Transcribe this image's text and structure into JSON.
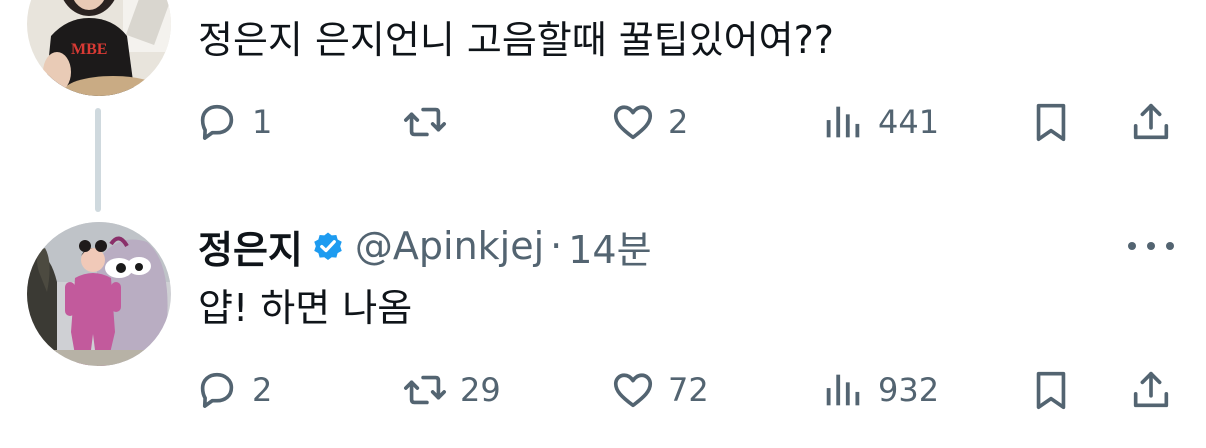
{
  "tweet1": {
    "text": "정은지 은지언니 고음할때 꿀팁있어여??",
    "replies": "1",
    "retweets": "",
    "likes": "2",
    "views": "441"
  },
  "tweet2": {
    "name": "정은지",
    "handle": "@Apinkjej",
    "separator": "·",
    "time": "14분",
    "text": "얍! 하면 나옴",
    "replies": "2",
    "retweets": "29",
    "likes": "72",
    "views": "932"
  },
  "icons": {
    "reply": "reply-icon",
    "retweet": "retweet-icon",
    "like": "heart-icon",
    "views": "views-chart-icon",
    "bookmark": "bookmark-icon",
    "share": "share-icon",
    "verified": "verified-badge-icon",
    "more": "more-icon"
  },
  "colors": {
    "text": "#0f1419",
    "secondary": "#536471",
    "verified": "#1d9bf0",
    "thread_line": "#cfd9de"
  }
}
